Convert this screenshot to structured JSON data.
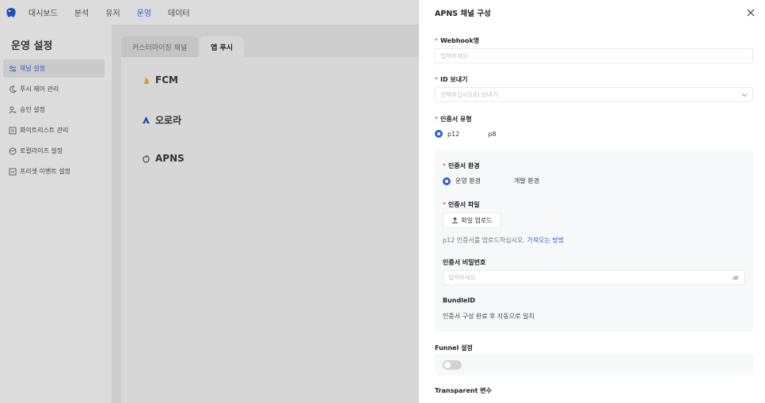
{
  "topnav": {
    "items": [
      "대시보드",
      "분석",
      "유저",
      "운영",
      "데이터"
    ],
    "active_index": 3
  },
  "sidebar": {
    "title": "운영 설정",
    "items": [
      {
        "label": "채널 설정",
        "icon": "sliders-icon"
      },
      {
        "label": "푸시 제어 관리",
        "icon": "moon-icon"
      },
      {
        "label": "승인 설정",
        "icon": "user-check-icon"
      },
      {
        "label": "화이트리스트 관리",
        "icon": "list-icon"
      },
      {
        "label": "로컬라이즈 설정",
        "icon": "globe-icon"
      },
      {
        "label": "프리셋 이벤트 설정",
        "icon": "preset-icon"
      }
    ],
    "active_index": 0
  },
  "main": {
    "tabs": [
      "커스터마이징 채널",
      "앱 푸시"
    ],
    "active_tab": 1,
    "channels": [
      {
        "name": "FCM",
        "icon": "firebase-icon"
      },
      {
        "name": "오로라",
        "icon": "aurora-icon"
      },
      {
        "name": "APNS",
        "icon": "apple-icon"
      }
    ]
  },
  "drawer": {
    "title": "APNS 채널 구성",
    "webhook": {
      "label": "Webhook명",
      "placeholder": "입력하세요"
    },
    "id_send": {
      "label": "ID 보내기",
      "placeholder": "선택하십시오ID 보내기"
    },
    "cert_type": {
      "label": "인증서 유형",
      "options": [
        "p12",
        "p8"
      ],
      "selected": "p12"
    },
    "cert_env": {
      "label": "인증서 환경",
      "options": [
        "운영 환경",
        "개발 환경"
      ],
      "selected": "운영 환경"
    },
    "cert_file": {
      "label": "인증서 파일",
      "button": "파일 업로드",
      "hint": "p12 인증서를 업로드하십시오.",
      "hint_link": "가져오는 방법"
    },
    "cert_password": {
      "label": "인증서 비밀번호",
      "placeholder": "입력하세요"
    },
    "bundle": {
      "label": "BundleID",
      "value": "인증서 구성 완료 후 자동으로 일치"
    },
    "funnel": {
      "label": "Funnel 설정",
      "enabled": false
    },
    "transparent": {
      "label": "Transparent 변수"
    }
  },
  "colors": {
    "accent": "#2c62d4",
    "required": "#e0453e",
    "overlay": "#d7d7d7"
  }
}
